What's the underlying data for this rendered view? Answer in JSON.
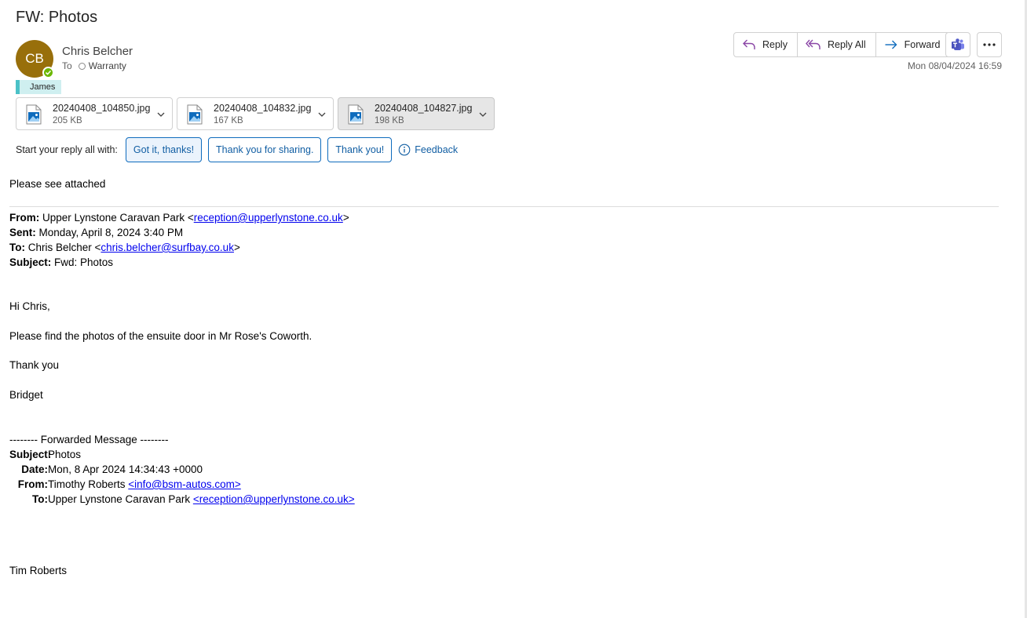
{
  "message": {
    "subject": "FW: Photos",
    "sender": {
      "initials": "CB",
      "name": "Chris Belcher",
      "avatar_color": "#986f0b",
      "presence_color": "#6bb700"
    },
    "to_label": "To",
    "to_recipient": "Warranty",
    "category": "James",
    "datetime": "Mon 08/04/2024 16:59"
  },
  "actions": {
    "reply": "Reply",
    "reply_all": "Reply All",
    "forward": "Forward",
    "teams_icon": "teams-icon",
    "more_icon": "more-horizontal-icon"
  },
  "attachments": [
    {
      "name": "20240408_104850.jpg",
      "size": "205 KB"
    },
    {
      "name": "20240408_104832.jpg",
      "size": "167 KB"
    },
    {
      "name": "20240408_104827.jpg",
      "size": "198 KB"
    }
  ],
  "quick_replies": {
    "label": "Start your reply all with:",
    "options": [
      "Got it, thanks!",
      "Thank you for sharing.",
      "Thank you!"
    ],
    "feedback": "Feedback"
  },
  "body": {
    "intro": "Please see attached",
    "header": {
      "from_label": "From:",
      "from_name": " Upper Lynstone Caravan Park <",
      "from_email": "reception@upperlynstone.co.uk",
      "from_close": ">",
      "sent_label": "Sent:",
      "sent_value": " Monday, April 8, 2024 3:40 PM",
      "to_label": "To:",
      "to_name": " Chris Belcher <",
      "to_email": "chris.belcher@surfbay.co.uk",
      "to_close": ">",
      "subject_label": "Subject:",
      "subject_value": " Fwd: Photos"
    },
    "greeting": "Hi Chris,",
    "message": "Please find the photos of the ensuite door in Mr Rose's Coworth.",
    "thanks": "Thank you",
    "signoff": "Bridget",
    "forwarded_marker": "-------- Forwarded Message --------",
    "forwarded": {
      "subject_label": "Subject:",
      "subject_value": "Photos",
      "date_label": "Date:",
      "date_value": "Mon, 8 Apr 2024 14:34:43 +0000",
      "from_label": "From:",
      "from_name": "Timothy Roberts ",
      "from_email": "<info@bsm-autos.com>",
      "to_label": "To:",
      "to_name": "Upper Lynstone Caravan Park ",
      "to_email": "<reception@upperlynstone.co.uk>"
    },
    "closing_name": "Tim Roberts"
  }
}
